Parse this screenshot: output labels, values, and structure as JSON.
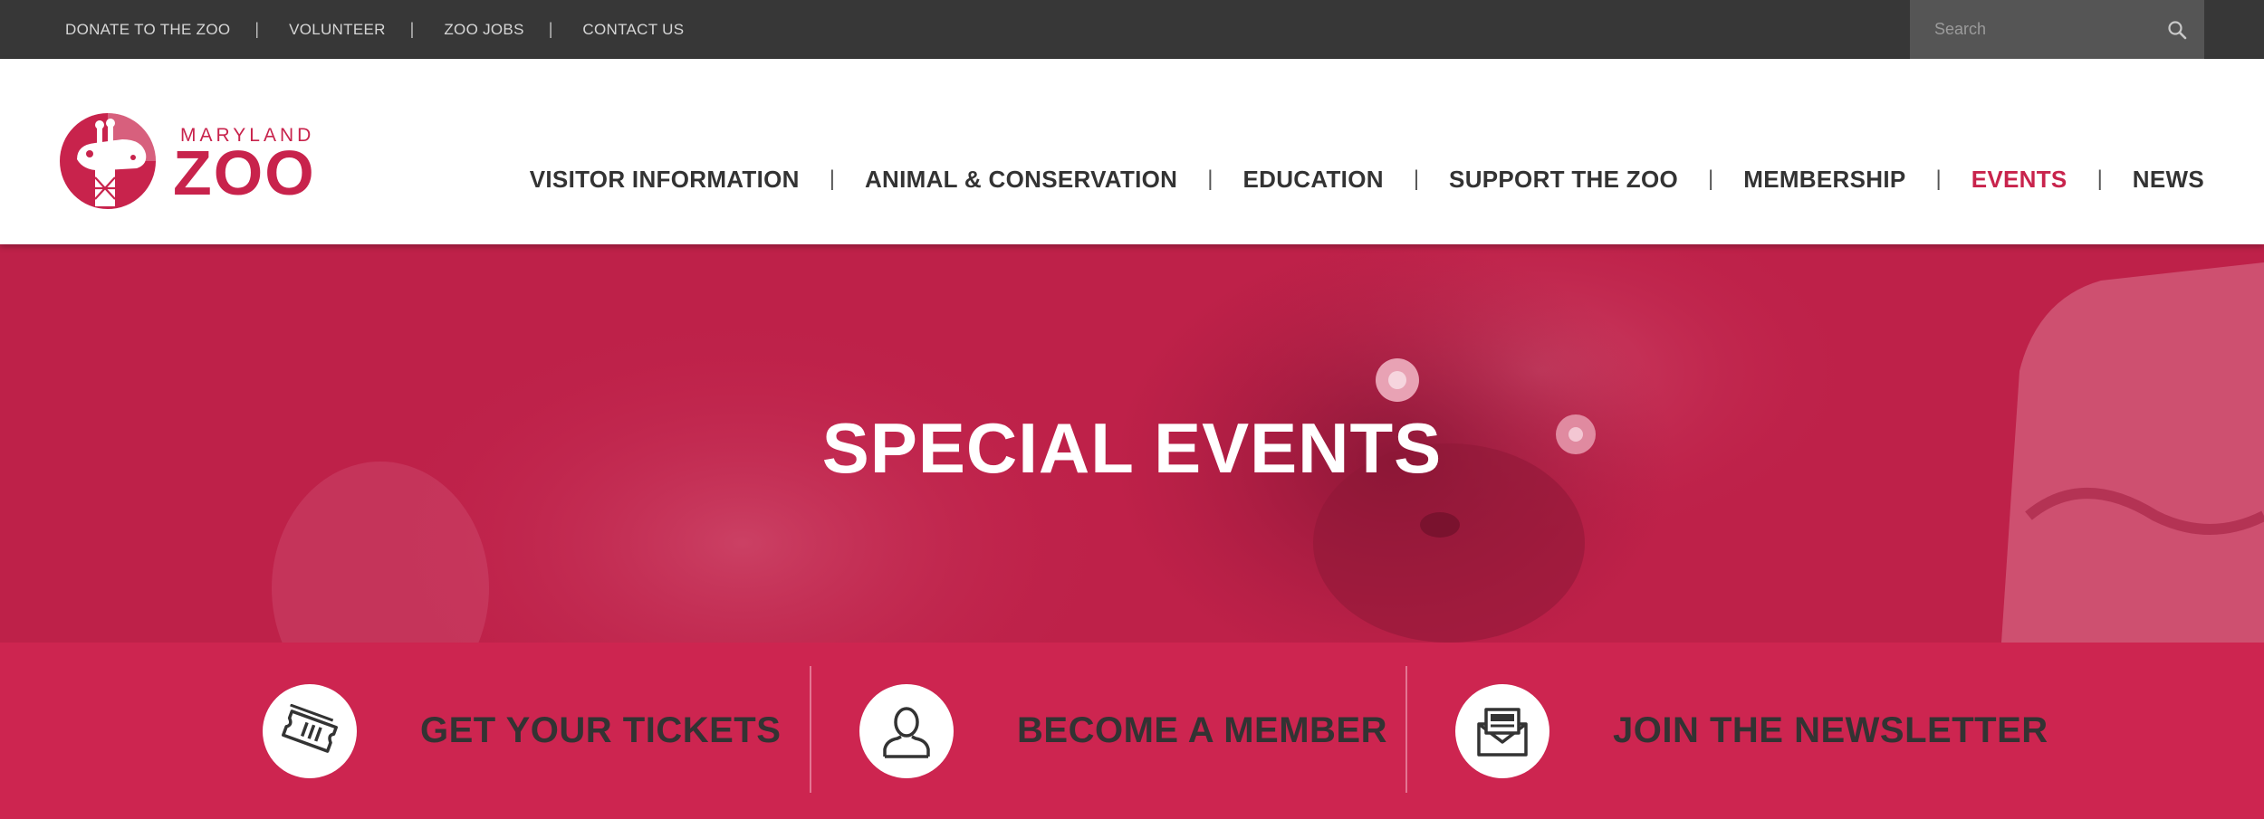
{
  "utility_nav": {
    "links": [
      "DONATE TO THE ZOO",
      "VOLUNTEER",
      "ZOO JOBS",
      "CONTACT US"
    ],
    "separator": "|"
  },
  "search": {
    "placeholder": "Search",
    "icon": "search-icon"
  },
  "logo": {
    "line1": "MARYLAND",
    "line2": "ZOO",
    "icon": "giraffe-logo-icon"
  },
  "main_nav": {
    "items": [
      "VISITOR INFORMATION",
      "ANIMAL & CONSERVATION",
      "EDUCATION",
      "SUPPORT THE ZOO",
      "MEMBERSHIP",
      "EVENTS",
      "NEWS"
    ],
    "active": "EVENTS",
    "separator": "|"
  },
  "hero": {
    "title": "SPECIAL EVENTS",
    "image": "lemur-photo-red-tint"
  },
  "cta": [
    {
      "label": "GET YOUR TICKETS",
      "icon": "ticket-icon"
    },
    {
      "label": "BECOME A MEMBER",
      "icon": "member-icon"
    },
    {
      "label": "JOIN THE NEWSLETTER",
      "icon": "newsletter-icon"
    }
  ],
  "colors": {
    "brand": "#c8234c",
    "utility_bar": "#373737",
    "search_bg": "#555555",
    "hero_tint": "#be2149",
    "cta_bg": "#cd2550",
    "text_dark": "#333333"
  }
}
